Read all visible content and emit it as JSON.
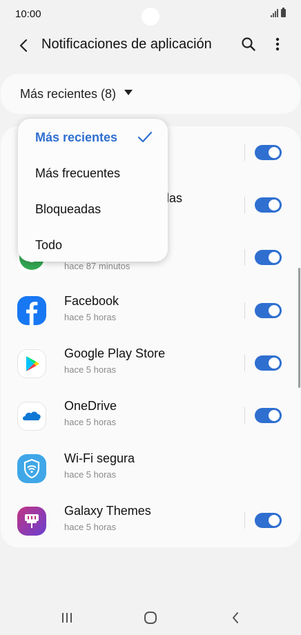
{
  "status_bar": {
    "time": "10:00"
  },
  "app_bar": {
    "title": "Notificaciones de aplicación"
  },
  "filter": {
    "label": "Más recientes (8)"
  },
  "dropdown": {
    "items": [
      {
        "label": "Más recientes",
        "selected": true
      },
      {
        "label": "Más frecuentes",
        "selected": false
      },
      {
        "label": "Bloqueadas",
        "selected": false
      },
      {
        "label": "Todo",
        "selected": false
      }
    ]
  },
  "apps": [
    {
      "name": "",
      "time": "",
      "enabled": true
    },
    {
      "name": "ulas",
      "time": "",
      "enabled": true
    },
    {
      "name": "",
      "time": "hace 87 minutos",
      "enabled": true
    },
    {
      "name": "Facebook",
      "time": "hace 5 horas",
      "enabled": true,
      "icon": "facebook-icon"
    },
    {
      "name": "Google Play Store",
      "time": "hace 5 horas",
      "enabled": true,
      "icon": "google-play-icon"
    },
    {
      "name": "OneDrive",
      "time": "hace 5 horas",
      "enabled": true,
      "icon": "onedrive-icon"
    },
    {
      "name": "Wi-Fi segura",
      "time": "hace 5 horas",
      "enabled": null,
      "icon": "wifi-secure-icon"
    },
    {
      "name": "Galaxy Themes",
      "time": "hace 5 horas",
      "enabled": true,
      "icon": "galaxy-themes-icon"
    }
  ],
  "colors": {
    "accent": "#2f6fd0",
    "background": "#f2f2f2",
    "card": "#fafafa"
  }
}
